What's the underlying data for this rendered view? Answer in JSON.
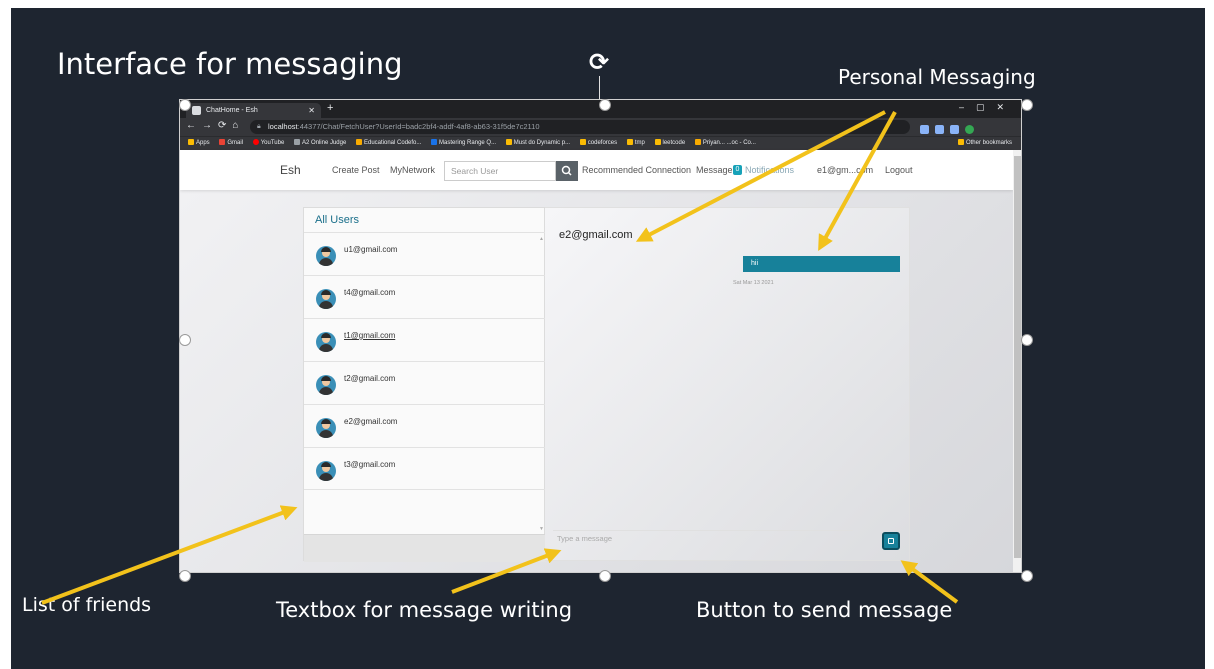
{
  "annotations": {
    "title": "Interface for messaging",
    "personal_messaging": "Personal Messaging",
    "list_of_friends": "List of friends",
    "textbox": "Textbox for message writing",
    "send_button": "Button to send message"
  },
  "browser": {
    "tab_title": "ChatHome - Esh",
    "url_host": "localhost",
    "url_rest": ":44377/Chat/FetchUser?UserId=badc2bf4-addf-4af8-ab63-31f5de7c2110",
    "bookmarks": [
      "Apps",
      "Gmail",
      "YouTube",
      "A2 Online Judge",
      "Educational Codefo...",
      "Mastering Range Q...",
      "Must do Dynamic p...",
      "codeforces",
      "tmp",
      "leetcode",
      "Priyan... ...oc - Co..."
    ],
    "other_bookmarks": "Other bookmarks"
  },
  "navbar": {
    "brand": "Esh",
    "create_post": "Create Post",
    "my_network": "MyNetwork",
    "search_placeholder": "Search User",
    "recommended": "Recommended Connection",
    "message": "Message",
    "notifications": "Notifications",
    "notifications_count": "0",
    "user": "e1@gm...com",
    "logout": "Logout"
  },
  "users_panel": {
    "title": "All Users",
    "users": [
      {
        "email": "u1@gmail.com"
      },
      {
        "email": "t4@gmail.com"
      },
      {
        "email": "t1@gmail.com"
      },
      {
        "email": "t2@gmail.com"
      },
      {
        "email": "e2@gmail.com"
      },
      {
        "email": "t3@gmail.com"
      }
    ]
  },
  "chat": {
    "with": "e2@gmail.com",
    "message_text": "hii",
    "message_time": "Sat Mar 13 2021",
    "input_placeholder": "Type a message"
  },
  "colors": {
    "slide_bg": "#1e2530",
    "accent": "#17819a",
    "arrow": "#f2c21b"
  }
}
